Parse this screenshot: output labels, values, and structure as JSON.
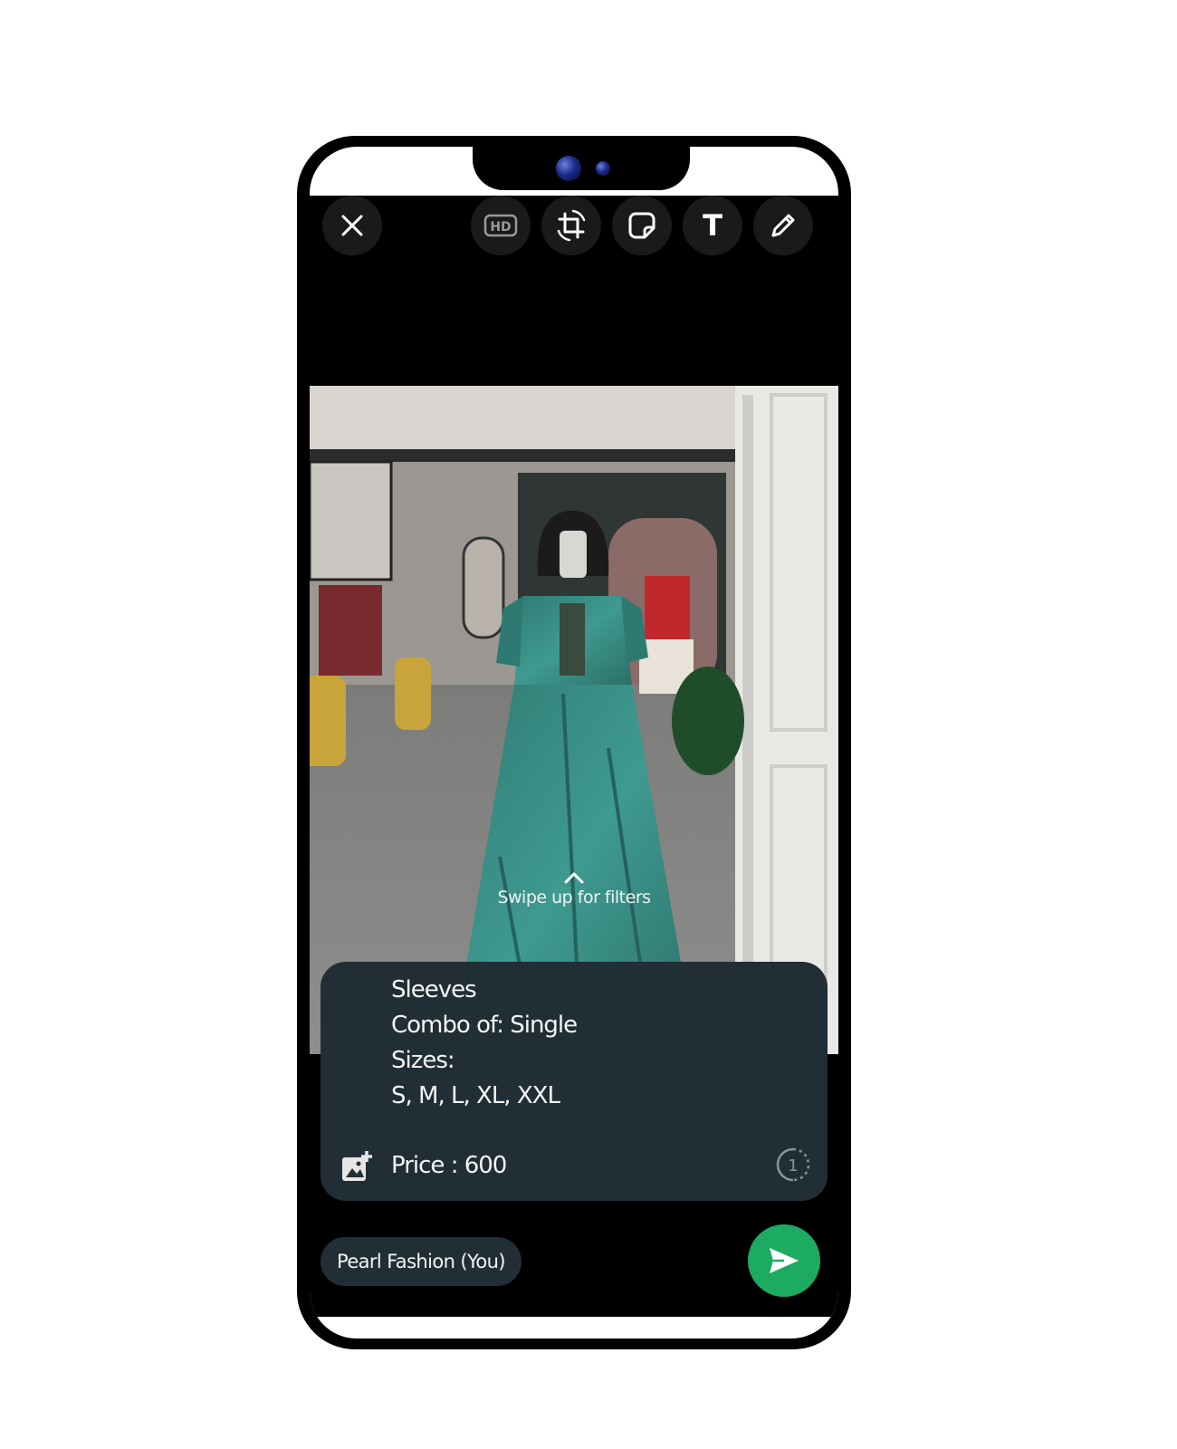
{
  "toolbar": {
    "close_icon": "close-icon",
    "hd_label": "HD",
    "rotate_icon": "crop-rotate-icon",
    "sticker_icon": "sticker-icon",
    "text_label": "T",
    "pencil_icon": "pencil-icon"
  },
  "image": {
    "description_icon": "product-photo",
    "swipe_hint": "Swipe up for filters"
  },
  "caption": {
    "lines": [
      "Sleeves",
      "Combo of: Single",
      "Sizes:",
      "S, M, L, XL, XXL"
    ],
    "price": "Price : 600",
    "add_media_icon": "add-photo-icon",
    "view_once_icon": "view-once-icon",
    "view_once_label": "1"
  },
  "footer": {
    "recipient": "Pearl Fashion (You)",
    "send_icon": "send-icon"
  },
  "colors": {
    "app_background": "#000000",
    "caption_background": "#222e35",
    "send_button": "#1daa61",
    "toolbar_button": "#1a1a1a"
  }
}
